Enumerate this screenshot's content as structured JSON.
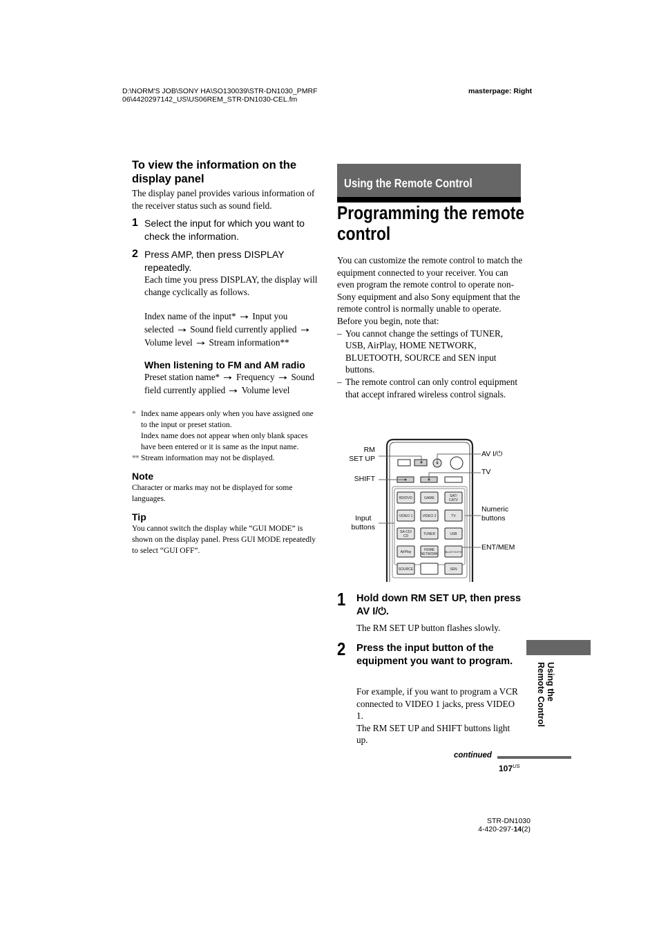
{
  "header": {
    "path_line1": "D:\\NORM'S JOB\\SONY HA\\SO130039\\STR-DN1030_PMRF",
    "path_line2": "06\\4420297142_US\\US06REM_STR-DN1030-CEL.fm",
    "masterpage": "masterpage: Right"
  },
  "left": {
    "heading": "To view the information on the display panel",
    "intro": "The display panel provides various information of the receiver status such as sound field.",
    "steps": [
      {
        "num": "1",
        "text": "Select the input for which you want to check the information."
      },
      {
        "num": "2",
        "text": "Press AMP, then press DISPLAY repeatedly.",
        "detail": "Each time you press DISPLAY, the display will change cyclically as follows."
      }
    ],
    "chain1": [
      "Index name of the input*",
      "Input you selected",
      "Sound field currently applied",
      "Volume level",
      "Stream information**"
    ],
    "fm_heading": "When listening to FM and AM radio",
    "chain2": [
      "Preset station name*",
      "Frequency",
      "Sound field currently applied",
      "Volume level"
    ],
    "footnotes": [
      {
        "mark": "*",
        "lines": [
          "Index name appears only when you have assigned one to the input or preset station.",
          "Index name does not appear when only blank spaces have been entered or it is same as the input name."
        ]
      },
      {
        "mark": "**",
        "lines": [
          "Stream information may not be displayed."
        ]
      }
    ],
    "note_heading": "Note",
    "note_text": "Character or marks may not be displayed for some languages.",
    "tip_heading": "Tip",
    "tip_text": "You cannot switch the display while “GUI MODE” is shown on the display panel. Press GUI MODE repeatedly to select “GUI OFF”."
  },
  "right": {
    "section_banner": "Using the Remote Control",
    "title": "Programming the remote control",
    "intro": "You can customize the remote control to match the equipment connected to your receiver. You can even program the remote control to operate non-Sony equipment and also Sony equipment that the remote control is normally unable to operate.",
    "before": "Before you begin, note that:",
    "notes": [
      "You cannot change the settings of TUNER, USB, AirPlay, HOME NETWORK, BLUETOOTH, SOURCE and SEN input buttons.",
      "The remote control can only control equipment that accept infrared wireless control signals."
    ],
    "diagram": {
      "labels": {
        "rm_setup_1": "RM",
        "rm_setup_2": "SET UP",
        "shift": "SHIFT",
        "input_1": "Input",
        "input_2": "buttons",
        "av_power": "AV I/⏻",
        "tv": "TV",
        "numeric_1": "Numeric",
        "numeric_2": "buttons",
        "ent_mem": "ENT/MEM"
      },
      "buttons": [
        [
          "BD/DVD",
          "GAME",
          "SAT/\nCATV"
        ],
        [
          "VIDEO 1",
          "VIDEO 2",
          "TV"
        ],
        [
          "SA-CD/\nCD",
          "TUNER",
          "USB"
        ],
        [
          "AirPlay",
          "HOME\nNETWORK",
          "BLUETOOTH"
        ],
        [
          "SOURCE",
          "",
          "SEN"
        ]
      ]
    },
    "steps": [
      {
        "num": "1",
        "heading": "Hold down RM SET UP, then press AV I/⏻.",
        "body": [
          "The RM SET UP button flashes slowly."
        ]
      },
      {
        "num": "2",
        "heading": "Press the input button of the equipment you want to program.",
        "body": [
          "For example, if you want to program a VCR connected to VIDEO 1 jacks, press VIDEO 1.",
          "The RM SET UP and SHIFT buttons light up."
        ]
      }
    ],
    "side_tab_line1": "Using the",
    "side_tab_line2": "Remote Control",
    "continued": "continued",
    "page_number": "107",
    "page_suffix": "US"
  },
  "footer": {
    "model": "STR-DN1030",
    "part_prefix": "4-420-297-",
    "part_bold": "14",
    "part_suffix": "(2)"
  }
}
